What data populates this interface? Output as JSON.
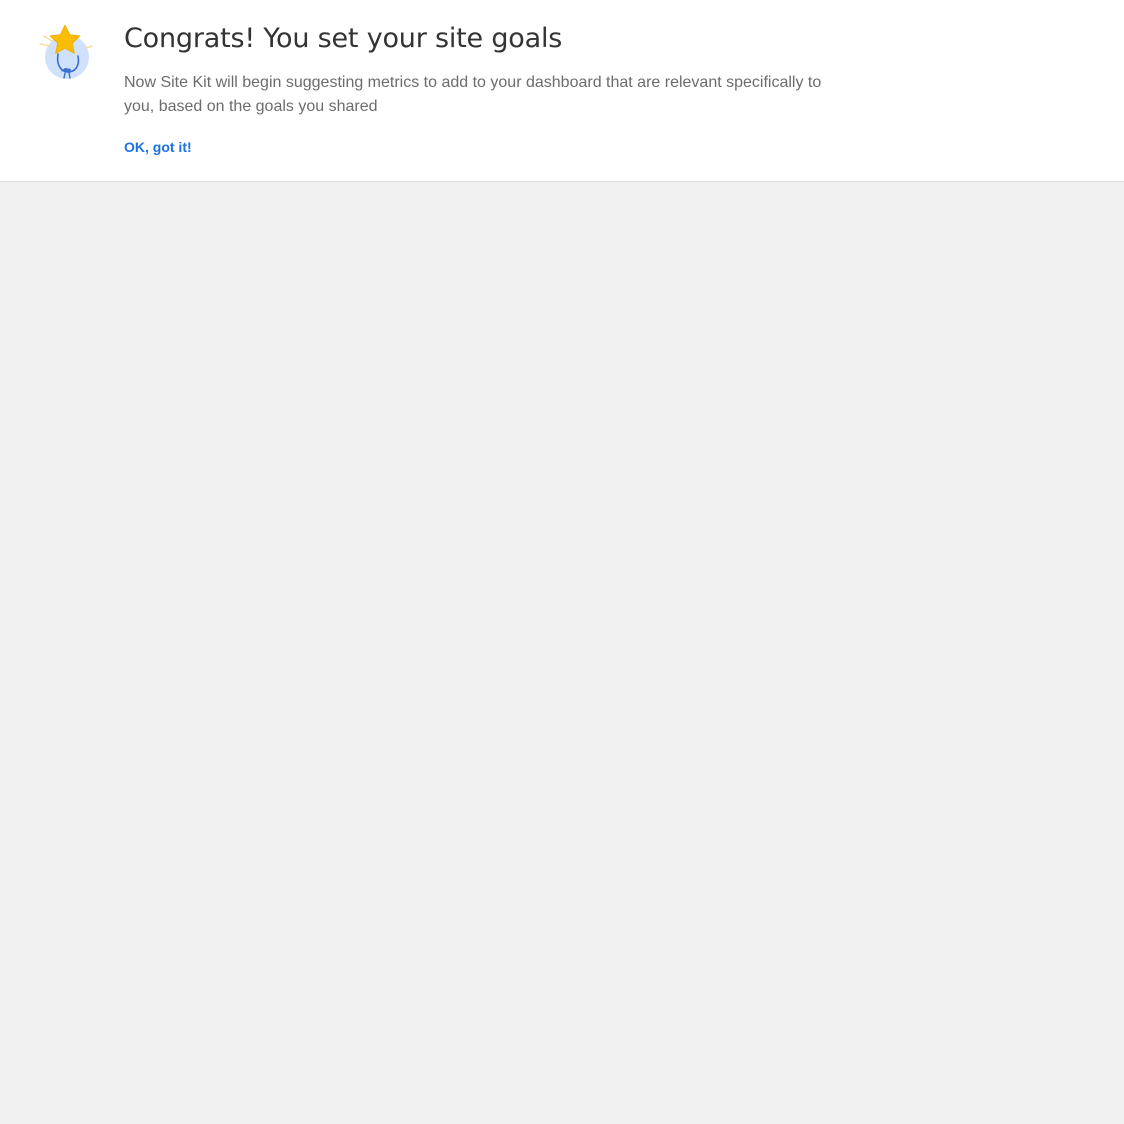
{
  "notice": {
    "icon": "celebration-star-icon",
    "title": "Congrats! You set your site goals",
    "description": "Now Site Kit will begin suggesting metrics to add to your dashboard that are relevant specifically to you, based on the goals you shared",
    "cta_label": "OK, got it!"
  },
  "colors": {
    "accent": "#1a73e8",
    "star": "#fbbc04",
    "icon_circle": "#cfe1fb",
    "icon_figure": "#3b6fd1",
    "background": "#f0f0f0",
    "title": "#333333",
    "description": "#6c6c6c"
  }
}
